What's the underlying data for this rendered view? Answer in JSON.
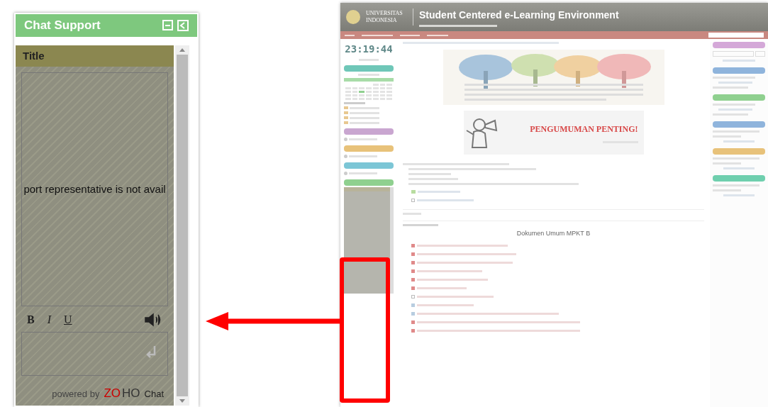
{
  "chat_widget": {
    "title": "Chat Support",
    "panel_title": "Title",
    "message": "port representative is not avail",
    "format_buttons": [
      "B",
      "I",
      "U"
    ],
    "powered_by": "powered by",
    "brand_first": "ZO",
    "brand_second": "HO",
    "brand_product": "Chat"
  },
  "site": {
    "university": "UNIVERSITAS INDONESIA",
    "title": "Student Centered e-Learning Environment",
    "clock": "23:19:44",
    "left_blocks": [
      {
        "kind": "calendar",
        "color": "#6fc7b8"
      },
      {
        "kind": "links",
        "color": "#c9a6d0"
      },
      {
        "kind": "links",
        "color": "#e8c27a"
      },
      {
        "kind": "links",
        "color": "#7cc6d6"
      },
      {
        "kind": "chat",
        "color": "#8fd08f"
      }
    ],
    "announcement": {
      "heading": "PENGUMUMAN PENTING!"
    },
    "section_title": "Dokumen Umum MPKT B",
    "resources": [
      {
        "kind": "forum"
      },
      {
        "kind": "page"
      }
    ],
    "documents": [
      {
        "kind": "pdf"
      },
      {
        "kind": "pdf"
      },
      {
        "kind": "pdf"
      },
      {
        "kind": "pdf"
      },
      {
        "kind": "pdf"
      },
      {
        "kind": "pdf"
      },
      {
        "kind": "page"
      },
      {
        "kind": "file"
      },
      {
        "kind": "file"
      },
      {
        "kind": "pdf"
      },
      {
        "kind": "pdf"
      }
    ],
    "right_blocks": [
      {
        "kind": "search",
        "color": "#d4a8d8"
      },
      {
        "kind": "list",
        "color": "#8fb4dc"
      },
      {
        "kind": "list",
        "color": "#8fd08f"
      },
      {
        "kind": "text",
        "color": "#8fb4dc"
      },
      {
        "kind": "text",
        "color": "#e8c27a"
      },
      {
        "kind": "text",
        "color": "#6fcfae"
      }
    ]
  }
}
